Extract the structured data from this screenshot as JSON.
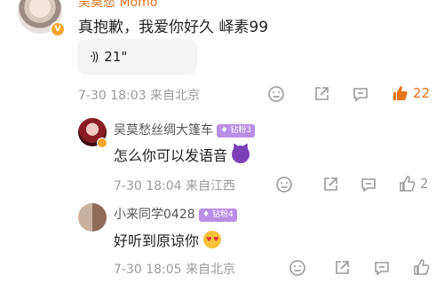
{
  "comment": {
    "username": "吴莫愁 Momo",
    "text": "真抱歉，我爱你好久 峄素99",
    "voice_duration": "21\"",
    "date": "7-30 18:03",
    "location": "来自北京",
    "like_count": "22"
  },
  "replies": [
    {
      "username": "吴莫愁丝绸大篷车",
      "badge": "钻粉3",
      "text": "怎么你可以发语音",
      "date": "7-30 18:04",
      "location": "来自江西",
      "like_count": "2"
    },
    {
      "username": "小来同学0428",
      "badge": "钻粉4",
      "text": "好听到原谅你",
      "date": "7-30 18:05",
      "location": "来自北京",
      "like_count": ""
    }
  ],
  "colors": {
    "accent_like": "#e8741c",
    "badge_purple": "#b98fe6",
    "meta_gray": "#9a9a9a"
  },
  "icons": [
    "dislike-icon",
    "share-icon",
    "comment-icon",
    "like-icon",
    "verified-badge-icon",
    "voice-wave-icon"
  ]
}
